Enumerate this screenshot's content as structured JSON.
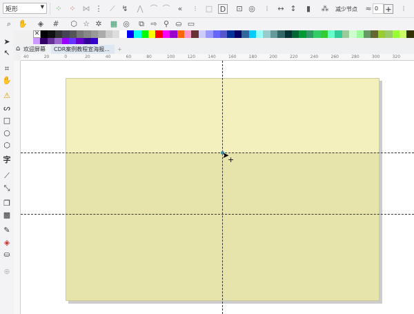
{
  "toolbar": {
    "shape_select": "矩形",
    "reduce_nodes_label": "减少节点",
    "smoothness_value": "0",
    "plus_label": "+"
  },
  "tabs": [
    {
      "label": "欢迎屏幕"
    },
    {
      "label": "CDR案例教程宣海报..."
    },
    {
      "label": "+"
    }
  ],
  "ruler_top": [
    "40",
    "20",
    "0",
    "20",
    "40",
    "60",
    "80",
    "100",
    "120",
    "140",
    "160",
    "180",
    "200",
    "220",
    "240",
    "260",
    "280",
    "300",
    "320"
  ],
  "palette_row1": [
    "#000000",
    "#111111",
    "#333333",
    "#444455",
    "#555555",
    "#777777",
    "#888888",
    "#999999",
    "#aaaaaa",
    "#cccccc",
    "#dddddd",
    "#ffffff",
    "#0000ff",
    "#00ffff",
    "#00ff00",
    "#ffff00",
    "#ff0000",
    "#ff00ff",
    "#9900cc",
    "#ff6600",
    "#ff99cc",
    "#663333",
    "#ccccff",
    "#9999ff",
    "#6666ff",
    "#5555cc",
    "#003399",
    "#000066",
    "#336699",
    "#00ccff",
    "#99ffff",
    "#99cccc",
    "#669999",
    "#336666",
    "#003333",
    "#006633",
    "#009933",
    "#339966",
    "#33cc66",
    "#33cc33",
    "#66ffcc",
    "#33cc99",
    "#99cc99",
    "#ccffcc",
    "#99ff99",
    "#669966",
    "#666633",
    "#99cc33",
    "#99cc66",
    "#99ff33",
    "#ccff66",
    "#333300",
    "#666600"
  ],
  "palette_row2": [
    "#cc99ff",
    "#330066",
    "#663399",
    "#9966cc",
    "#9900ff",
    "#6633ff",
    "#6600cc",
    "#330099",
    "#3300cc"
  ],
  "colors": {
    "rect_top": "#f3f0bd",
    "rect_bottom": "#e6e3ab",
    "guide": "#333333"
  }
}
